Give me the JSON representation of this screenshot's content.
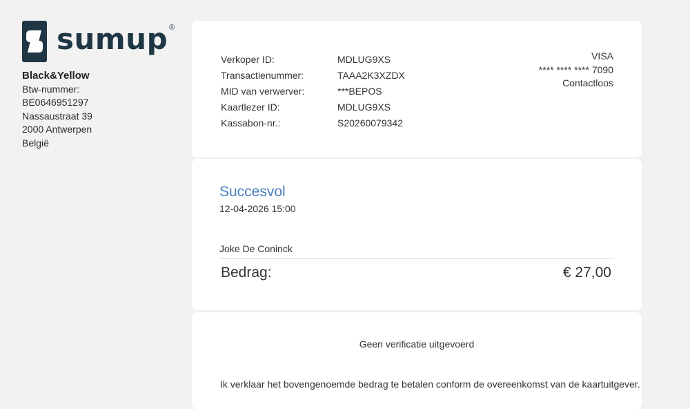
{
  "brand": {
    "logo_text": "sumup",
    "reg_mark": "®",
    "accent_color": "#1f3644"
  },
  "merchant": {
    "name": "Black&Yellow",
    "vat_label": "Btw-nummer:",
    "vat_number": "BE0646951297",
    "street": "Nassaustraat 39",
    "city": "2000 Antwerpen",
    "country": "België"
  },
  "transaction_details": [
    {
      "label": "Verkoper ID:",
      "value": "MDLUG9XS"
    },
    {
      "label": "Transactienummer:",
      "value": "TAAA2K3XZDX"
    },
    {
      "label": "MID van verwerver:",
      "value": "***BEPOS"
    },
    {
      "label": "Kaartlezer ID:",
      "value": "MDLUG9XS"
    },
    {
      "label": "Kassabon-nr.:",
      "value": "S20260079342"
    }
  ],
  "card": {
    "brand": "VISA",
    "masked_number": "**** **** **** 7090",
    "method": "Contactloos"
  },
  "payment": {
    "status": "Succesvol",
    "status_color": "#4a7fbf",
    "datetime": "12-04-2026 15:00",
    "customer": "Joke De Coninck",
    "amount_label": "Bedrag:",
    "amount_value": "€ 27,00"
  },
  "footer": {
    "verification": "Geen verificatie uitgevoerd",
    "declaration": "Ik verklaar het bovengenoemde bedrag te betalen conform de overeenkomst van de kaartuitgever."
  }
}
